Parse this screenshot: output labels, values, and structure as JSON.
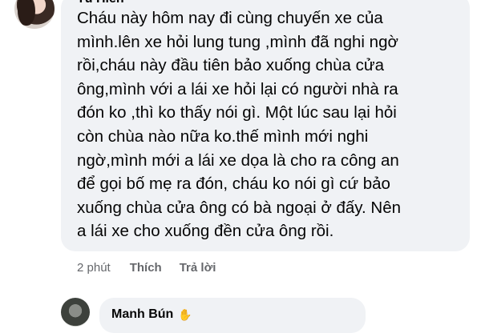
{
  "comment": {
    "author": "Tú Hiền",
    "text": "Cháu này hôm nay đi cùng chuyến xe của\nmình.lên xe hỏi lung tung ,mình đã nghi ngờ\nrồi,cháu này đầu tiên bảo xuống chùa cửa\nông,mình với a lái xe hỏi lại có người nhà ra\nđón ko ,thì ko thấy nói gì. Một lúc sau lại hỏi\ncòn chùa nào nữa ko.thế mình mới nghi\nngờ,mình mới a lái xe dọa là cho ra công an\nđể gọi bố mẹ ra đón, cháu ko nói gì cứ bảo\nxuống chùa cửa ông có bà ngoại ở đấy. Nên\na lái xe cho xuống đền cửa ông rồi.",
    "time": "2 phút",
    "like_label": "Thích",
    "reply_label": "Trả lời"
  },
  "reply": {
    "author": "Manh Bún",
    "author_badge_icon": "hand-wave-icon"
  }
}
